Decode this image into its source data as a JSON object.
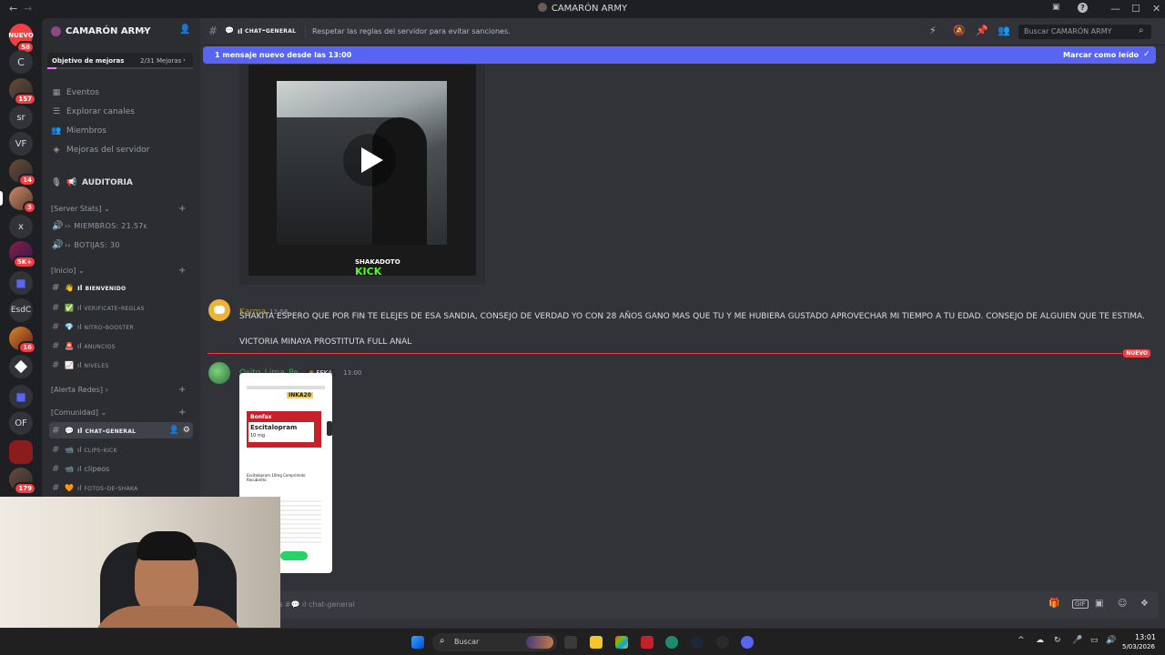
{
  "window": {
    "title": "CAMARÓN ARMY",
    "back": "←",
    "forward": "→",
    "minimize": "—",
    "maximize": "☐",
    "close": "✕"
  },
  "rail": {
    "new_label": "NUEVO",
    "badges": {
      "new": "58",
      "srv2": "157",
      "srv5": "14",
      "srv6": "3",
      "srv8": "5K+",
      "srv11": "16",
      "srv16": "179"
    },
    "initials": {
      "c": "C",
      "sr": "sr",
      "vf": "VF",
      "x": "x",
      "esdc": "EsdC",
      "of": "OF"
    }
  },
  "server": {
    "name": "CAMARÓN ARMY",
    "boost_label": "Objetivo de mejoras",
    "boost_progress": "2/31 Mejoras",
    "boost_fraction": 0.0645,
    "menu": [
      "Eventos",
      "Explorar canales",
      "Miembros",
      "Mejoras del servidor"
    ],
    "auditoria": "AUDITORIA",
    "stats_category": "[Server Stats]",
    "stats": [
      "MIEMBROS: 21.57k",
      "BOTIJAS: 30"
    ],
    "cat_inicio": "[Inicio]",
    "inicio_channels": [
      "bienvenido",
      "verificate-reglas",
      "nitro-booster",
      "anuncios",
      "niveles"
    ],
    "cat_alerta": "[Alerta Redes]",
    "cat_comunidad": "[Comunidad]",
    "comunidad_channels": [
      "chat-general",
      "clips-kick",
      "clipeos",
      "fotos-de-shaka"
    ]
  },
  "chat": {
    "channel": "chat-general",
    "topic": "Respetar las reglas del servidor para evitar sanciones.",
    "search_placeholder": "Buscar CAMARÓN ARMY",
    "new_messages": "1 mensaje nuevo desde las 13:00",
    "mark_read": "Marcar como leído",
    "video_watermark": "SHAKADOTO",
    "video_brand": "KICK",
    "messages": [
      {
        "author": "Karma",
        "time": "12:58",
        "lines": [
          "SHAKITA ESPERO QUE POR FIN TE ELEJES DE ESA SANDIA, CONSEJO DE VERDAD YO CON 28 AÑOS GANO MAS QUE TU Y ME HUBIERA GUSTADO APROVECHAR MI TIEMPO A TU EDAD. CONSEJO DE ALGUIEN QUE TE ESTIMA.",
          "VICTORIA MINAYA PROSTITUTA FULL ANAL"
        ]
      },
      {
        "author": "Osito_Lima_Pe",
        "tag": "FEKA",
        "time": "13:00",
        "attachment": {
          "promo_code": "INKA20",
          "brand": "Bonfax",
          "product": "Escitalopram",
          "dose": "10 mg",
          "caption": "Escitalopram 10mg Comprimido Recubierto"
        }
      }
    ],
    "divider_label": "NUEVO",
    "composer_placeholder": "Enviar mensaje a #💬 ıl chat-general"
  },
  "taskbar": {
    "search": "Buscar",
    "time": "13:01",
    "date": "5/03/2026"
  },
  "colors": {
    "accent": "#5865f2",
    "danger": "#f23f43",
    "karma": "#a8953b",
    "osito": "#3ba55d"
  }
}
